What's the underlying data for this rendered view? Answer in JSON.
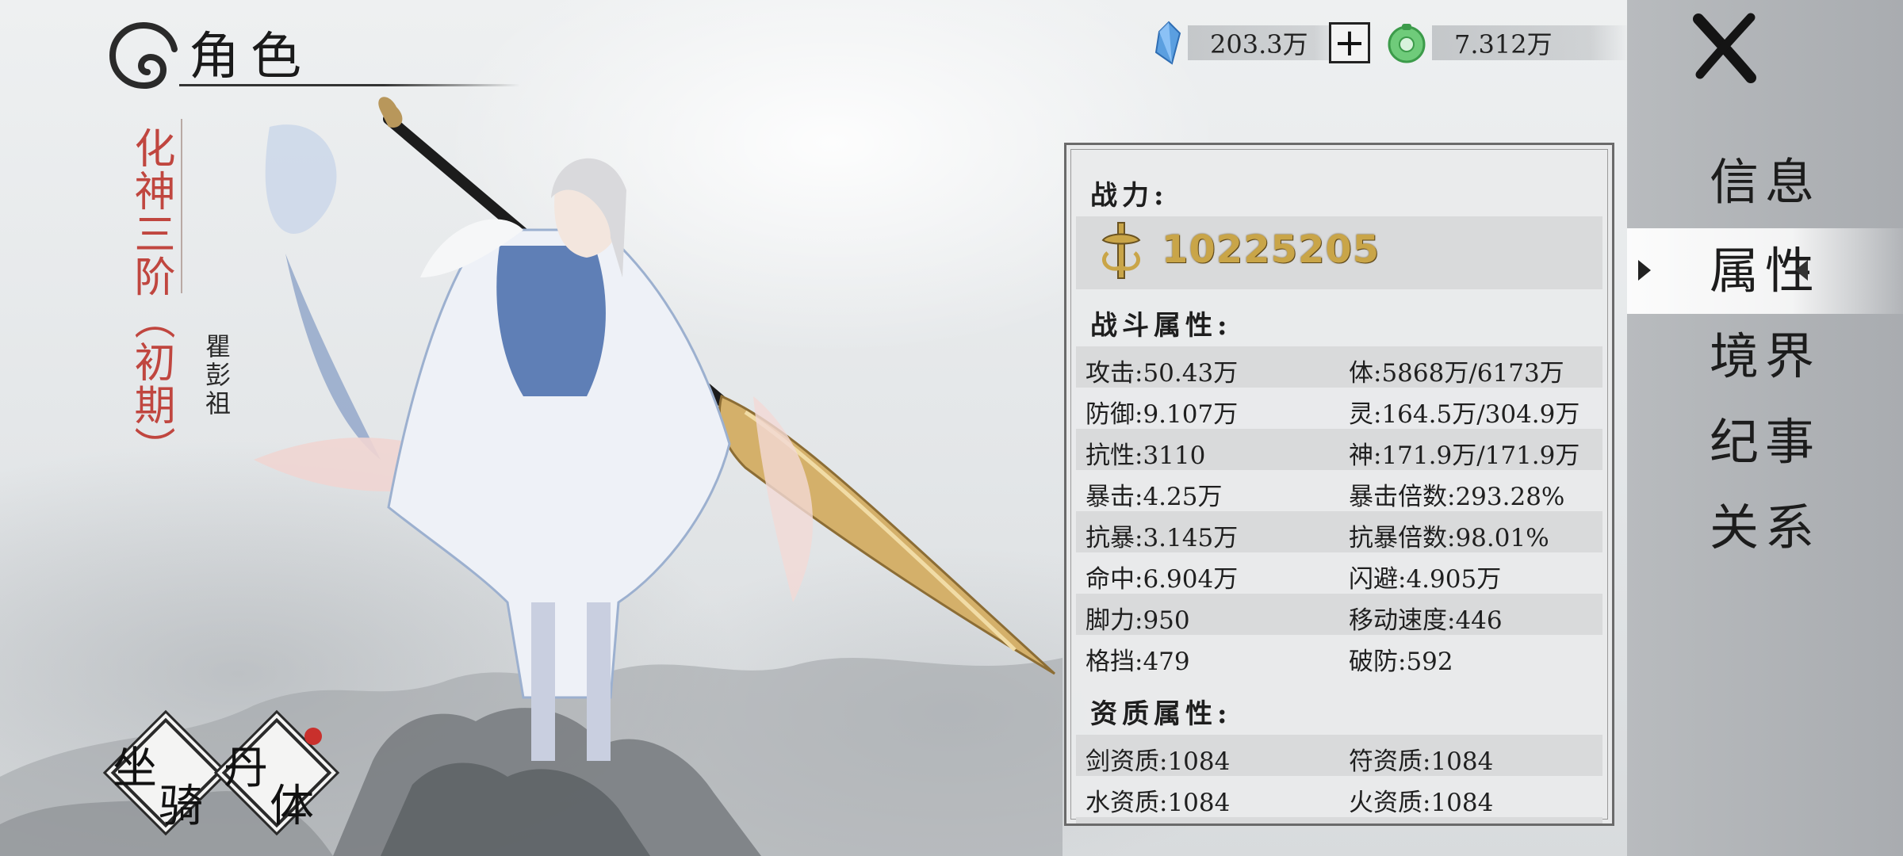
{
  "title": "角色",
  "character": {
    "realm": "化神三阶（初期）",
    "name": "瞿彭祖"
  },
  "currency": {
    "crystal_value": "203.3万",
    "jade_value": "7.312万",
    "crystal_icon": "blue-crystal-icon",
    "jade_icon": "jade-coin-icon"
  },
  "menu": {
    "items": [
      "信息",
      "属性",
      "境界",
      "纪事",
      "关系"
    ],
    "active": "属性"
  },
  "panel": {
    "power_label": "战力:",
    "power_value": "10225205",
    "combat_label": "战斗属性:",
    "combat_stats": [
      [
        "攻击:50.43万",
        "体:5868万/6173万"
      ],
      [
        "防御:9.107万",
        "灵:164.5万/304.9万"
      ],
      [
        "抗性:3110",
        "神:171.9万/171.9万"
      ],
      [
        "暴击:4.25万",
        "暴击倍数:293.28%"
      ],
      [
        "抗暴:3.145万",
        "抗暴倍数:98.01%"
      ],
      [
        "命中:6.904万",
        "闪避:4.905万"
      ],
      [
        "脚力:950",
        "移动速度:446"
      ],
      [
        "格挡:479",
        "破防:592"
      ]
    ],
    "aptitude_label": "资质属性:",
    "aptitude_stats": [
      [
        "剑资质:1084",
        "符资质:1084"
      ],
      [
        "水资质:1084",
        "火资质:1084"
      ]
    ]
  },
  "bottom_buttons": {
    "mount": [
      "坐",
      "骑"
    ],
    "body": [
      "丹",
      "体"
    ]
  },
  "colors": {
    "realm_text": "#c0463f",
    "power_gold": "#c9a548",
    "notification_dot": "#c9302c"
  }
}
